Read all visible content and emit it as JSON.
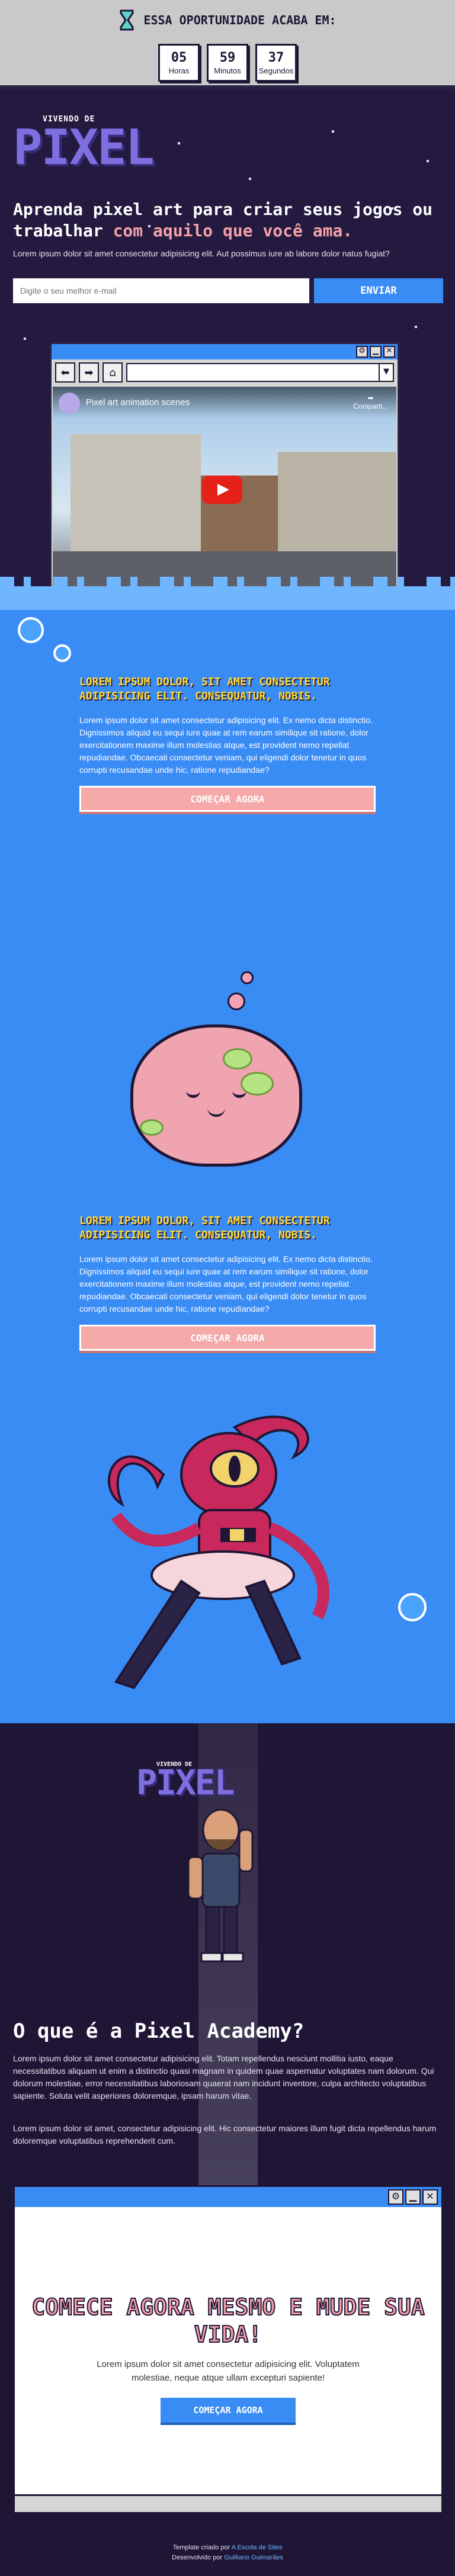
{
  "topbar": {
    "title": "ESSA OPORTUNIDADE ACABA EM:",
    "counter": [
      {
        "value": "05",
        "label": "Horas"
      },
      {
        "value": "59",
        "label": "Minutos"
      },
      {
        "value": "37",
        "label": "Segundos"
      }
    ]
  },
  "hero": {
    "logo_small": "VIVENDO DE",
    "logo_big": "PIXEL",
    "heading_plain": "Aprenda pixel art para criar seus jogos ou trabalhar",
    "heading_highlight": "com aquilo que você ama.",
    "paragraph": "Lorem ipsum dolor sit amet consectetur adipisicing elit. Aut possimus iure ab labore dolor natus fugiat?",
    "email_placeholder": "Digite o seu melhor e-mail",
    "submit_label": "ENVIAR",
    "video_title": "Pixel art animation scenes",
    "video_share": "Comparti..."
  },
  "features": [
    {
      "heading": "LOREM IPSUM DOLOR, SIT AMET CONSECTETUR ADIPISICING ELIT. CONSEQUATUR, NOBIS.",
      "text": "Lorem ipsum dolor sit amet consectetur adipisicing elit. Ex nemo dicta distinctio. Dignissimos aliquid eu sequi iure quae at rem earum similique sit ratione, dolor exercitationem maxime illum molestias atque, est provident nemo repellat repudiandae. Obcaecati consectetur veniam, qui eligendi dolor tenetur in quos corrupti recusandae unde hic, ratione repudiandae?",
      "button": "COMEÇAR AGORA"
    },
    {
      "heading": "LOREM IPSUM DOLOR, SIT AMET CONSECTETUR ADIPISICING ELIT. CONSEQUATUR, NOBIS.",
      "text": "Lorem ipsum dolor sit amet consectetur adipisicing elit. Ex nemo dicta distinctio. Dignissimos aliquid eu sequi iure quae at rem earum similique sit ratione, dolor exercitationem maxime illum molestias atque, est provident nemo repellat repudiandae. Obcaecati consectetur veniam, qui eligendi dolor tenetur in quos corrupti recusandae unde hic, ratione repudiandae?",
      "button": "COMEÇAR AGORA"
    }
  ],
  "about": {
    "logo_small": "VIVENDO DE",
    "logo_big": "PIXEL",
    "title": "O que é a Pixel Academy?",
    "p1": "Lorem ipsum dolor sit amet consectetur adipisicing elit. Totam repellendus nesciunt mollitia iusto, eaque necessitatibus aliquam ut enim a distinctio quasi magnam in quidem quae aspernatur voluptates nam dolorum. Qui dolorum molestiae, error necessitatibus laboriosam quaerat nam incidunt inventore, culpa architecto voluptatibus sapiente. Soluta velit asperiores doloremque, ipsam harum vitae.",
    "p2": "Lorem ipsum dolor sit amet, consectetur adipisicing elit. Hic consectetur maiores illum fugit dicta repellendus harum doloremque voluptatibus reprehenderit cum."
  },
  "cta": {
    "title": "COMECE AGORA MESMO E MUDE SUA VIDA!",
    "text": "Lorem ipsum dolor sit amet consectetur adipisicing elit. Voluptatem molestiae, neque atque ullam excepturi sapiente!",
    "button": "COMEÇAR AGORA"
  },
  "footer": {
    "line1_prefix": "Template criado por",
    "line1_link": "A Escola de Sites",
    "line2_prefix": "Desenvolvido por",
    "line2_link": "Guilliano Guimarães"
  },
  "colors": {
    "accent_blue": "#3a8cf5",
    "dark_bg": "#1f1636",
    "highlight_pink": "#f4a0a8",
    "heading_yellow": "#ffd836"
  },
  "icons": [
    "hourglass-icon",
    "back-arrow-icon",
    "forward-arrow-icon",
    "home-icon",
    "settings-icon",
    "minimize-icon",
    "close-icon",
    "dropdown-icon",
    "play-icon",
    "share-icon"
  ]
}
